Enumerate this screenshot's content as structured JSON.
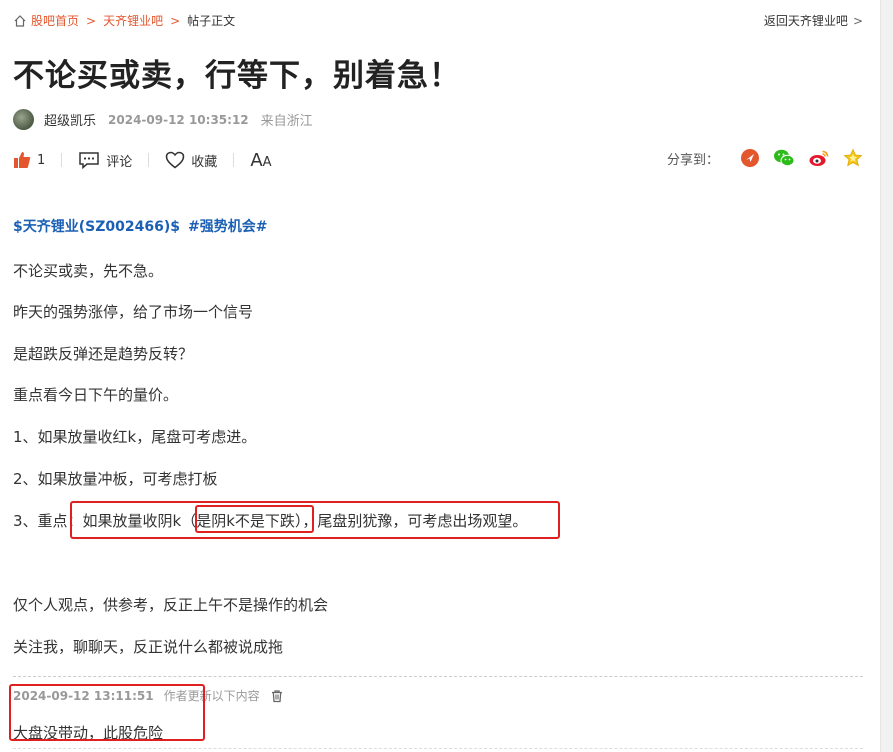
{
  "breadcrumb": {
    "items": [
      "股吧首页",
      "天齐锂业吧"
    ],
    "current": "帖子正文",
    "back": "返回天齐锂业吧"
  },
  "post": {
    "title": "不论买或卖，行等下，别着急！",
    "author": "超级凯乐",
    "time": "2024-09-12 10:35:12",
    "location": "来自浙江"
  },
  "actions": {
    "likes": "1",
    "comment": "评论",
    "favorite": "收藏",
    "font_big": "A",
    "font_small": "A",
    "share_label": "分享到："
  },
  "content": {
    "stock_tag": "$天齐锂业(SZ002466)$",
    "topic_tag": "#强势机会#",
    "lines": [
      "不论买或卖，先不急。",
      "昨天的强势涨停，给了市场一个信号",
      "是超跌反弹还是趋势反转？",
      "重点看今日下午的量价。",
      "1、如果放量收红k，尾盘可考虑进。",
      "2、如果放量冲板，可考虑打板",
      "3、重点：如果放量收阴k（是阴k不是下跌），尾盘别犹豫，可考虑出场观望。",
      "仅个人观点，供参考，反正上午不是操作的机会",
      "关注我，聊聊天，反正说什么都被说成拖"
    ]
  },
  "update": {
    "time": "2024-09-12 13:11:51",
    "note": "作者更新以下内容",
    "text": "大盘没带动，此股危险"
  },
  "colors": {
    "accent_orange": "#e4572e",
    "link_blue": "#1b60b5",
    "annotation_red": "#e02020"
  },
  "icons": [
    "home-icon",
    "chevron-right-icon",
    "thumbs-up-icon",
    "comment-icon",
    "heart-icon",
    "font-size-icon",
    "share-weibo-tencent-icon",
    "share-wechat-icon",
    "share-weibo-icon",
    "share-star-icon",
    "trash-icon"
  ]
}
